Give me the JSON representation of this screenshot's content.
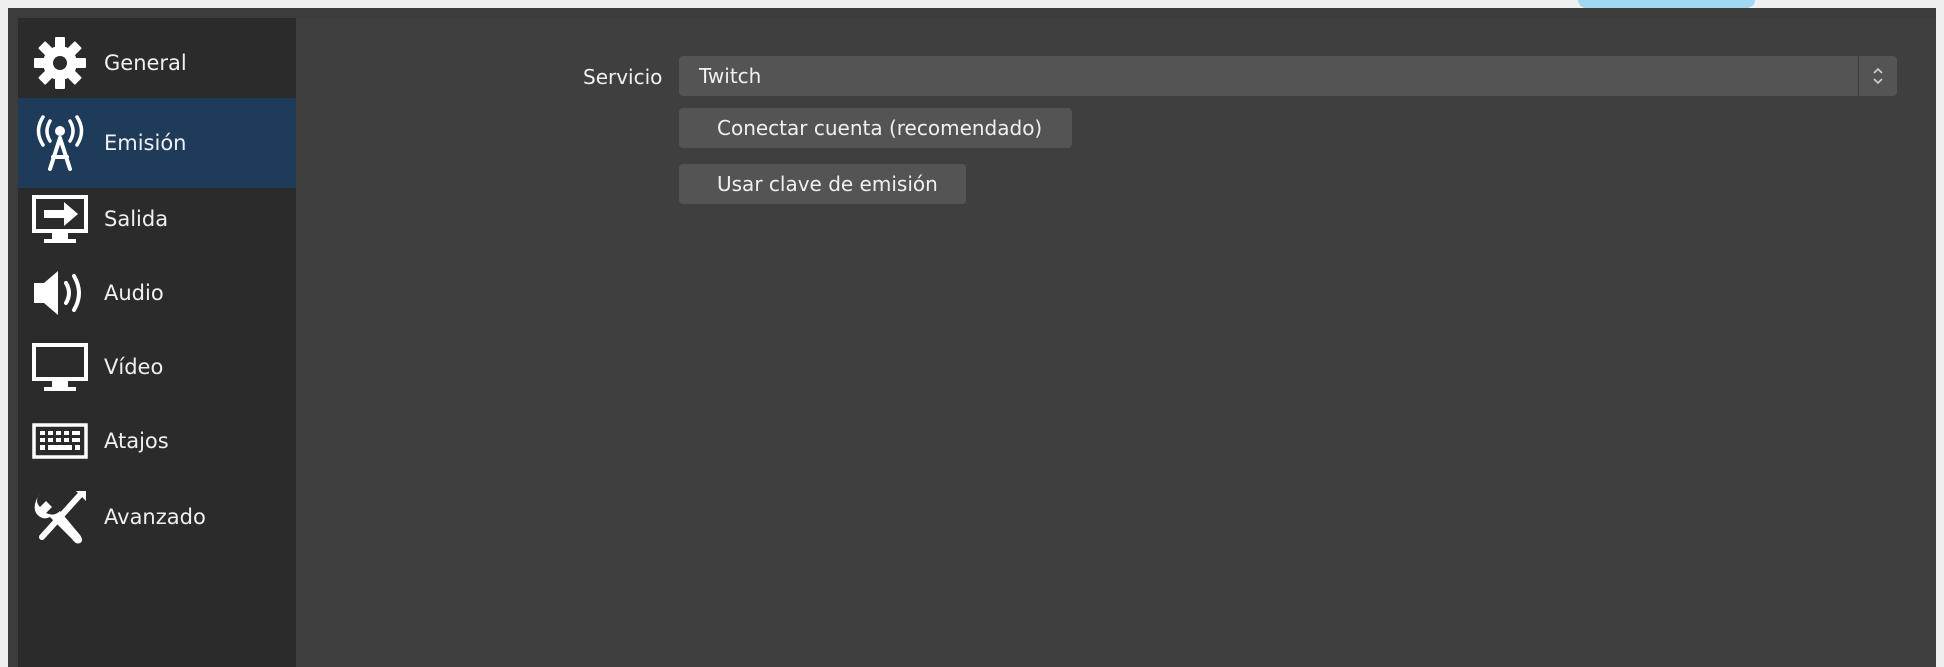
{
  "sidebar": {
    "items": [
      {
        "label": "General",
        "icon": "gear-icon",
        "selected": false
      },
      {
        "label": "Emisión",
        "icon": "broadcast-antenna-icon",
        "selected": true
      },
      {
        "label": "Salida",
        "icon": "monitor-output-icon",
        "selected": false
      },
      {
        "label": "Audio",
        "icon": "speaker-icon",
        "selected": false
      },
      {
        "label": "Vídeo",
        "icon": "monitor-icon",
        "selected": false
      },
      {
        "label": "Atajos",
        "icon": "keyboard-icon",
        "selected": false
      },
      {
        "label": "Avanzado",
        "icon": "tools-icon",
        "selected": false
      }
    ]
  },
  "stream": {
    "service_label": "Servicio",
    "service_value": "Twitch",
    "connect_button": "Conectar cuenta (recomendado)",
    "stream_key_button": "Usar clave de emisión"
  },
  "colors": {
    "sidebar_bg": "#2b2b2b",
    "selected_bg": "#1e3b5a",
    "content_bg": "#3f3f3f",
    "control_bg": "#545454",
    "text": "#f0f0f0"
  }
}
